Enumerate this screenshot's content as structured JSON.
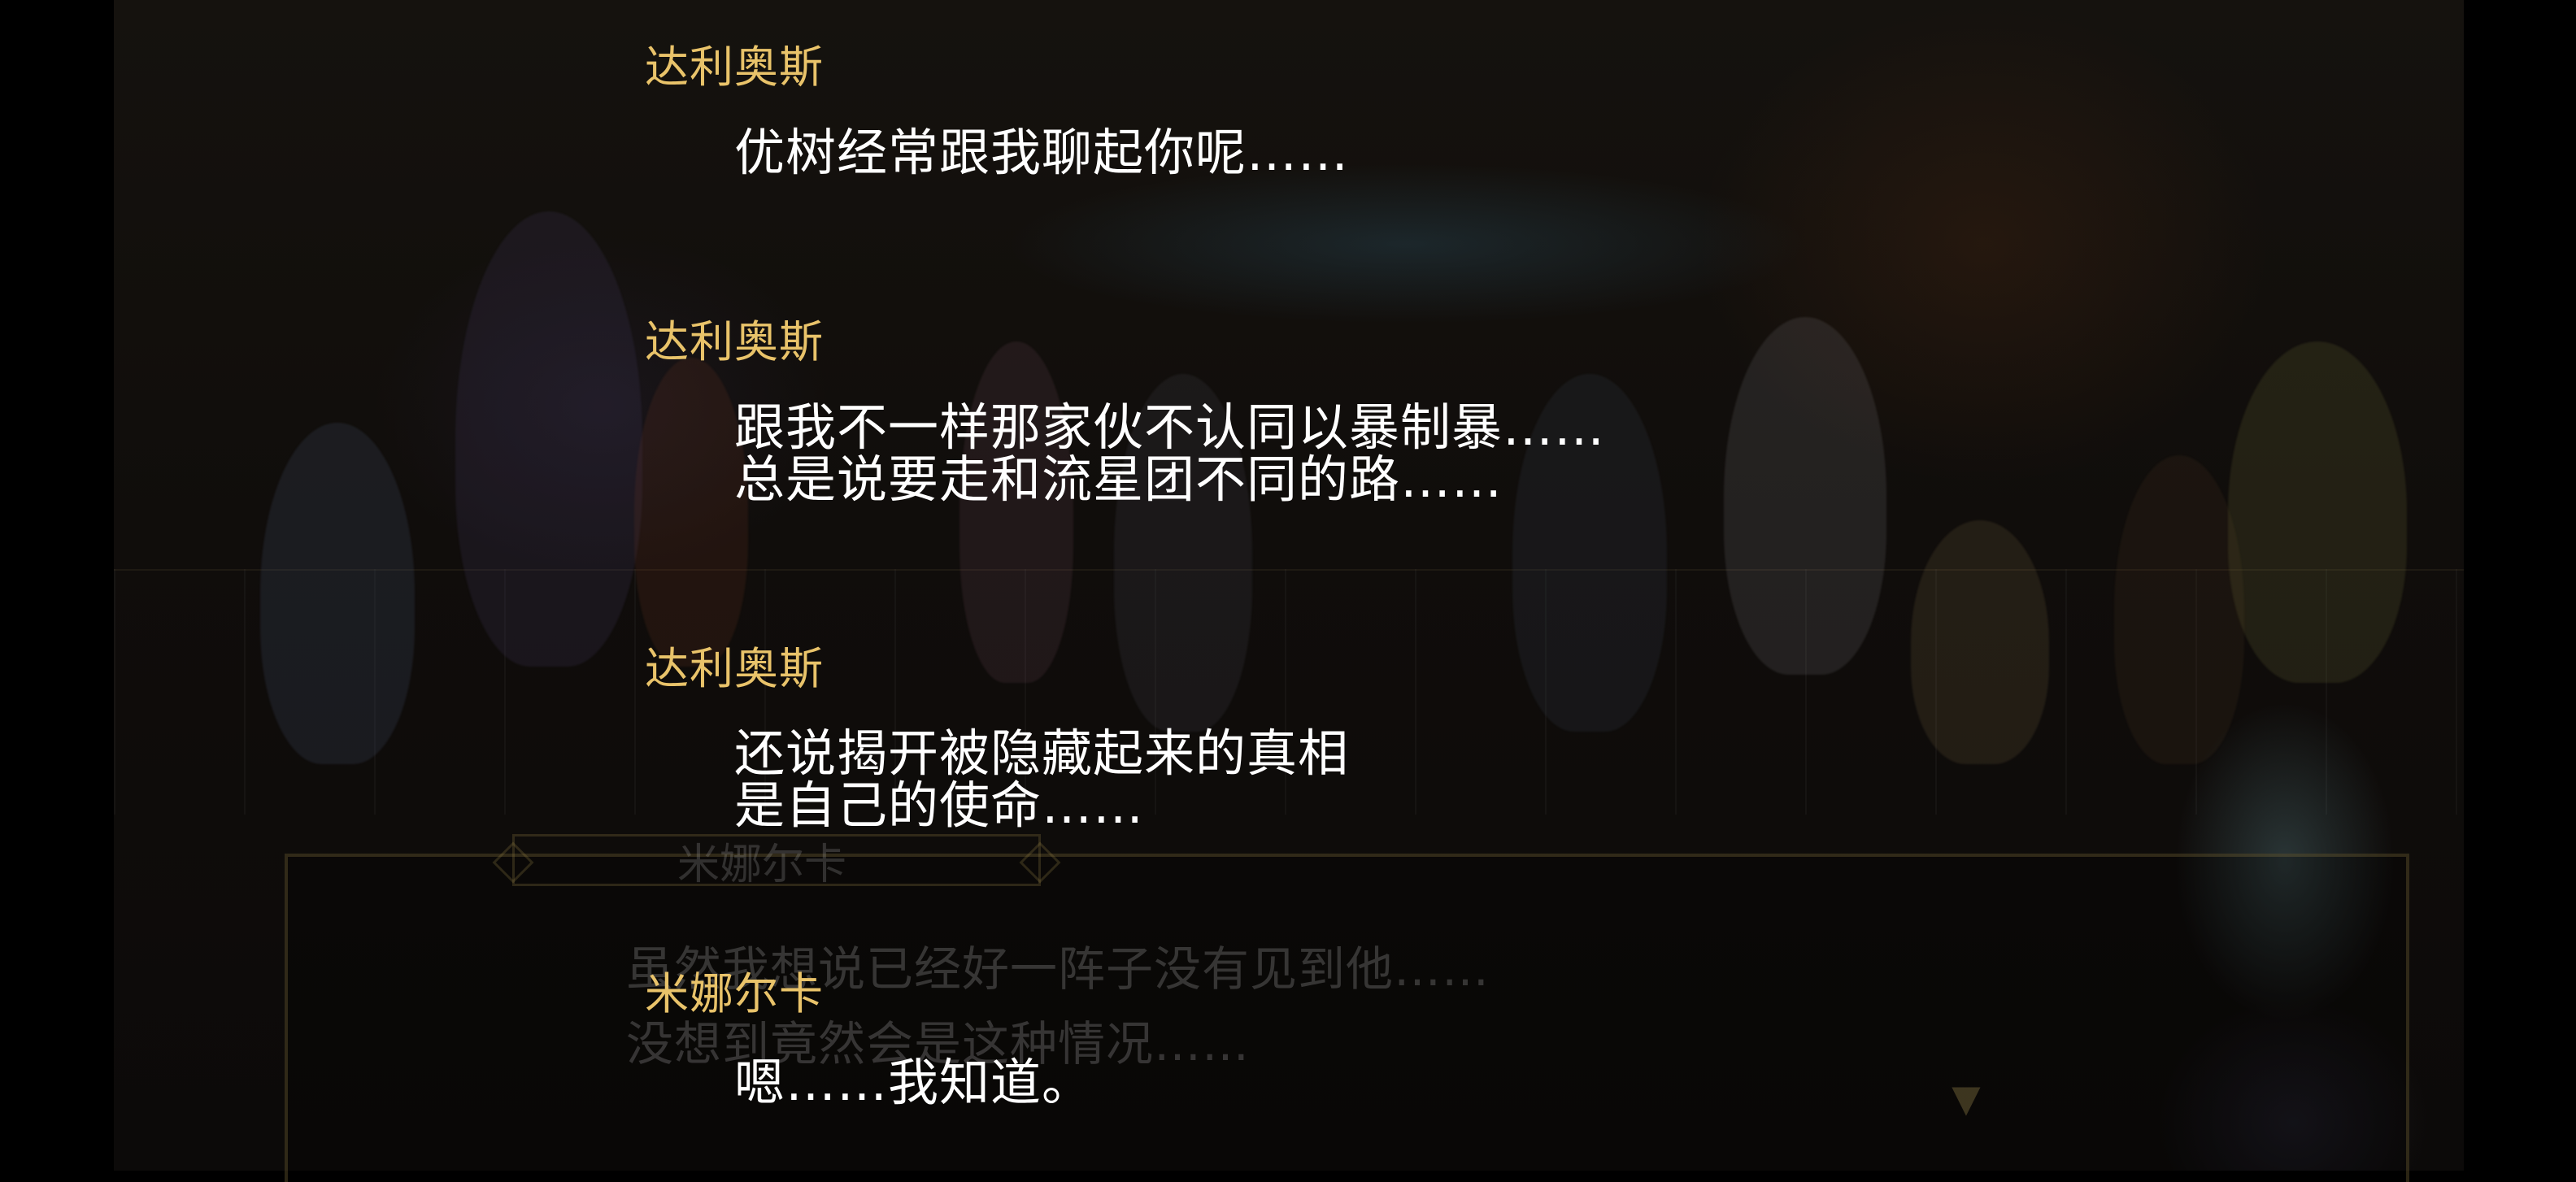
{
  "scene": {
    "dialog_box": {
      "speaker": "米娜尔卡",
      "lines": [
        "虽然我想说已经好一阵子没有见到他……",
        "没想到竟然会是这种情况……"
      ]
    },
    "icons": {
      "advance": "advance-arrow-icon"
    }
  },
  "backlog": {
    "entries": [
      {
        "speaker": "达利奥斯",
        "lines": [
          "优树经常跟我聊起你呢……"
        ]
      },
      {
        "speaker": "达利奥斯",
        "lines": [
          "跟我不一样那家伙不认同以暴制暴……",
          "总是说要走和流星团不同的路……"
        ]
      },
      {
        "speaker": "达利奥斯",
        "lines": [
          "还说揭开被隐藏起来的真相",
          "是自己的使命……"
        ]
      },
      {
        "speaker": "米娜尔卡",
        "lines": [
          "嗯……我知道。"
        ]
      }
    ],
    "colors": {
      "speaker": "#e9c36a",
      "text": "#ffffff"
    }
  }
}
